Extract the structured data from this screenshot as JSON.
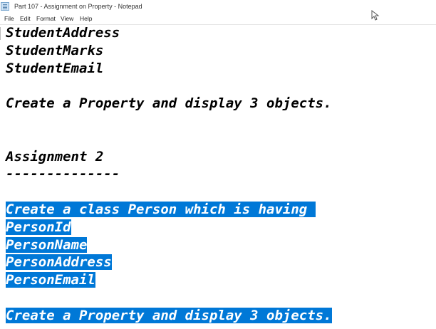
{
  "window": {
    "title": "Part 107 - Assignment on Property - Notepad"
  },
  "menu": [
    "File",
    "Edit",
    "Format",
    "View",
    "Help"
  ],
  "editor": {
    "lines": [
      {
        "text": "StudentAddress",
        "selected": false
      },
      {
        "text": "StudentMarks",
        "selected": false
      },
      {
        "text": "StudentEmail",
        "selected": false
      },
      {
        "text": "",
        "selected": false
      },
      {
        "text": "Create a Property and display 3 objects.",
        "selected": false
      },
      {
        "text": "",
        "selected": false
      },
      {
        "text": "",
        "selected": false
      },
      {
        "text": "Assignment 2",
        "selected": false
      },
      {
        "text": "--------------",
        "selected": false
      },
      {
        "text": "",
        "selected": false
      },
      {
        "text": "Create a class Person which is having ",
        "selected": true
      },
      {
        "text": "PersonId",
        "selected": true
      },
      {
        "text": "PersonName",
        "selected": true
      },
      {
        "text": "PersonAddress",
        "selected": true
      },
      {
        "text": "PersonEmail",
        "selected": true
      },
      {
        "text": "",
        "selected": false
      },
      {
        "text": "Create a Property and display 3 objects.",
        "selected": true
      }
    ]
  },
  "colors": {
    "selection": "#0078d7",
    "selection_text": "#ffffff",
    "text": "#000000"
  }
}
